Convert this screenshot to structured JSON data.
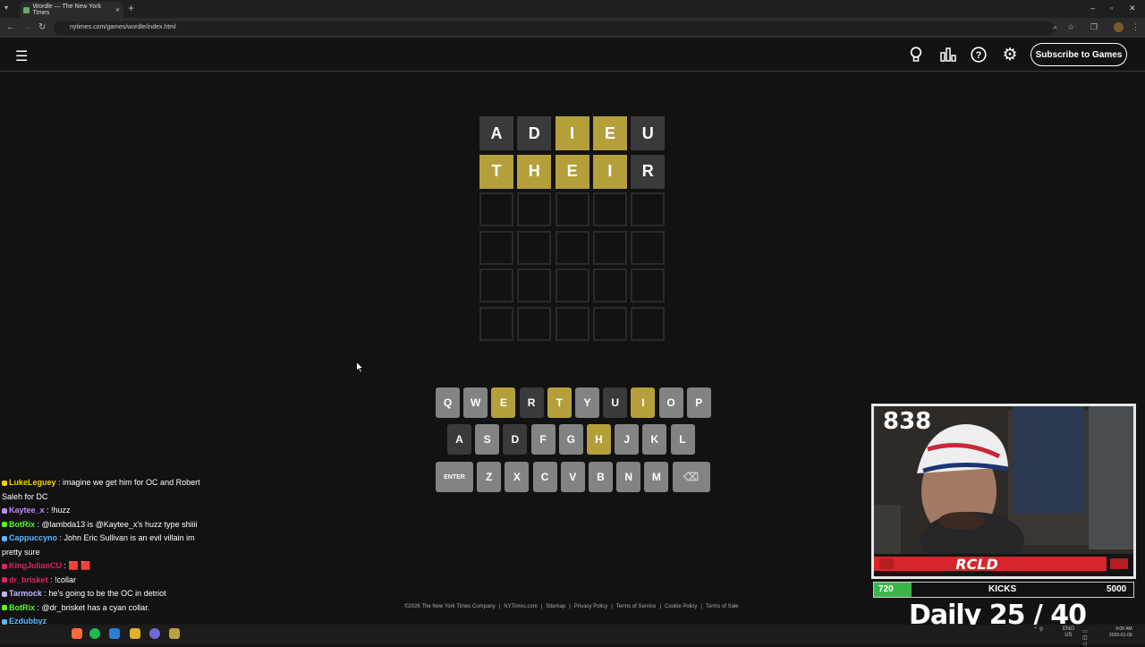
{
  "browser": {
    "tab_title": "Wordle — The New York Times",
    "url": "nytimes.com/games/wordle/index.html"
  },
  "header": {
    "subscribe_label": "Subscribe to Games"
  },
  "board": {
    "rows": [
      [
        {
          "letter": "A",
          "state": "absent"
        },
        {
          "letter": "D",
          "state": "absent"
        },
        {
          "letter": "I",
          "state": "present"
        },
        {
          "letter": "E",
          "state": "present"
        },
        {
          "letter": "U",
          "state": "absent"
        }
      ],
      [
        {
          "letter": "T",
          "state": "present"
        },
        {
          "letter": "H",
          "state": "present"
        },
        {
          "letter": "E",
          "state": "present"
        },
        {
          "letter": "I",
          "state": "present"
        },
        {
          "letter": "R",
          "state": "absent"
        }
      ],
      [
        {
          "letter": "",
          "state": "empty"
        },
        {
          "letter": "",
          "state": "empty"
        },
        {
          "letter": "",
          "state": "empty"
        },
        {
          "letter": "",
          "state": "empty"
        },
        {
          "letter": "",
          "state": "empty"
        }
      ],
      [
        {
          "letter": "",
          "state": "empty"
        },
        {
          "letter": "",
          "state": "empty"
        },
        {
          "letter": "",
          "state": "empty"
        },
        {
          "letter": "",
          "state": "empty"
        },
        {
          "letter": "",
          "state": "empty"
        }
      ],
      [
        {
          "letter": "",
          "state": "empty"
        },
        {
          "letter": "",
          "state": "empty"
        },
        {
          "letter": "",
          "state": "empty"
        },
        {
          "letter": "",
          "state": "empty"
        },
        {
          "letter": "",
          "state": "empty"
        }
      ],
      [
        {
          "letter": "",
          "state": "empty"
        },
        {
          "letter": "",
          "state": "empty"
        },
        {
          "letter": "",
          "state": "empty"
        },
        {
          "letter": "",
          "state": "empty"
        },
        {
          "letter": "",
          "state": "empty"
        }
      ]
    ]
  },
  "keyboard": {
    "rows": [
      [
        {
          "k": "Q",
          "s": "unused"
        },
        {
          "k": "W",
          "s": "unused"
        },
        {
          "k": "E",
          "s": "present"
        },
        {
          "k": "R",
          "s": "absent"
        },
        {
          "k": "T",
          "s": "present"
        },
        {
          "k": "Y",
          "s": "unused"
        },
        {
          "k": "U",
          "s": "absent"
        },
        {
          "k": "I",
          "s": "present"
        },
        {
          "k": "O",
          "s": "unused"
        },
        {
          "k": "P",
          "s": "unused"
        }
      ],
      [
        {
          "k": "A",
          "s": "absent"
        },
        {
          "k": "S",
          "s": "unused"
        },
        {
          "k": "D",
          "s": "absent"
        },
        {
          "k": "F",
          "s": "unused"
        },
        {
          "k": "G",
          "s": "unused"
        },
        {
          "k": "H",
          "s": "present"
        },
        {
          "k": "J",
          "s": "unused"
        },
        {
          "k": "K",
          "s": "unused"
        },
        {
          "k": "L",
          "s": "unused"
        }
      ],
      [
        {
          "k": "ENTER",
          "s": "unused"
        },
        {
          "k": "Z",
          "s": "unused"
        },
        {
          "k": "X",
          "s": "unused"
        },
        {
          "k": "C",
          "s": "unused"
        },
        {
          "k": "V",
          "s": "unused"
        },
        {
          "k": "B",
          "s": "unused"
        },
        {
          "k": "N",
          "s": "unused"
        },
        {
          "k": "M",
          "s": "unused"
        },
        {
          "k": "⌫",
          "s": "unused"
        }
      ]
    ]
  },
  "footer": {
    "links": [
      "©2026 The New York Times Company",
      "NYTimes.com",
      "Sitemap",
      "Privacy Policy",
      "Terms of Service",
      "Cookie Policy",
      "Terms of Sale"
    ]
  },
  "chat": {
    "messages": [
      {
        "user": "LukeLeguey",
        "color": "#f5d000",
        "text": "imagine we get him for OC and Robert Saleh for DC"
      },
      {
        "user": "Kaytee_x",
        "color": "#c08cff",
        "text": "!huzz"
      },
      {
        "user": "BotRix",
        "color": "#53fc18",
        "text": "@lambda13 is @Kaytee_x's huzz type shiiii"
      },
      {
        "user": "Cappuccyno",
        "color": "#5ab8ff",
        "text": "John Eric Sullivan is an evil villain im pretty sure"
      },
      {
        "user": "KingJulianCU",
        "color": "#e0245e",
        "text": "🟥 🟥"
      },
      {
        "user": "dr_brisket",
        "color": "#e0245e",
        "text": "!collar"
      },
      {
        "user": "Tarmock",
        "color": "#c8b4ff",
        "text": "he's going to be the OC in detriot"
      },
      {
        "user": "BotRix",
        "color": "#53fc18",
        "text": "@dr_brisket has a cyan collar."
      },
      {
        "user": "Ezdubbyz",
        "color": "#5ab8ff",
        "text": ""
      }
    ]
  },
  "overlay": {
    "viewer_count": "838",
    "kicks_current": "720",
    "kicks_label": "KICKS",
    "kicks_goal": "5000",
    "kicks_progress": 0.144,
    "daily_label": "Daily 25 / 40"
  },
  "taskbar": {
    "lang": "ENG",
    "region": "US",
    "time": "9:08 AM",
    "date": "2026-01-09"
  },
  "colors": {
    "present": "#b59f3b",
    "absent": "#3a3a3c",
    "unused_key": "#818384",
    "background": "#121213"
  }
}
